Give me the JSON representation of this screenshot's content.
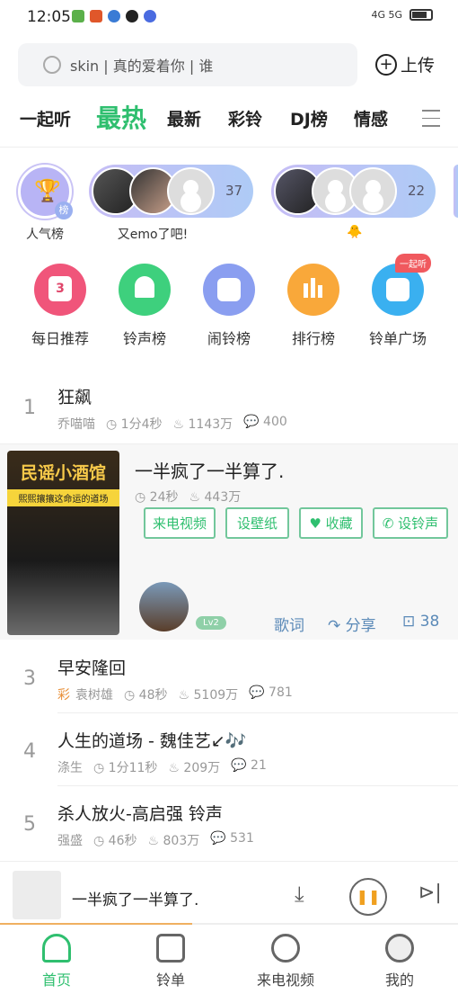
{
  "status": {
    "time": "12:05",
    "network": "4G 5G"
  },
  "search": {
    "placeholder": "skin | 真的爱着你 | 谁",
    "upload": "上传"
  },
  "tabs": [
    "一起听",
    "最热",
    "最新",
    "彩铃",
    "DJ榜",
    "情感"
  ],
  "accent": "#2fbf6f",
  "rooms": [
    {
      "label": "人气榜",
      "badge": "榜"
    },
    {
      "label": "又emo了吧!",
      "count": "37"
    },
    {
      "label": "🐥",
      "count": "22"
    }
  ],
  "features": [
    {
      "label": "每日推荐",
      "icon": "calendar-icon",
      "color": "#f0557a",
      "glyph": "3"
    },
    {
      "label": "铃声榜",
      "icon": "bell-icon",
      "color": "#3ed07d"
    },
    {
      "label": "闹铃榜",
      "icon": "alarm-icon",
      "color": "#8a9ef0"
    },
    {
      "label": "排行榜",
      "icon": "chart-icon",
      "color": "#f9a83a"
    },
    {
      "label": "铃单广场",
      "icon": "list-icon",
      "color": "#3ab0f0",
      "badge": "一起听"
    }
  ],
  "songs": [
    {
      "rank": "1",
      "title": "狂飙",
      "artist": "乔喵喵",
      "duration": "1分4秒",
      "plays": "1143万",
      "comments": "400"
    },
    {
      "title": "一半疯了一半算了.",
      "duration": "24秒",
      "plays": "443万",
      "thumb_title": "民谣小酒馆",
      "thumb_sub": "熙熙攘攘这命运的道场",
      "level": "Lv2",
      "actions": [
        "来电视频",
        "设壁纸",
        "收藏",
        "设铃声"
      ],
      "lyrics": "歌词",
      "share": "分享",
      "comments": "38"
    },
    {
      "rank": "3",
      "title": "早安隆回",
      "tag": "彩",
      "artist": "袁树雄",
      "duration": "48秒",
      "plays": "5109万",
      "comments": "781"
    },
    {
      "rank": "4",
      "title": "人生的道场 - 魏佳艺↙🎶",
      "artist": "涤生",
      "duration": "1分11秒",
      "plays": "209万",
      "comments": "21"
    },
    {
      "rank": "5",
      "title": "杀人放火-高启强 铃声",
      "artist": "强盛",
      "duration": "46秒",
      "plays": "803万",
      "comments": "531"
    }
  ],
  "player": {
    "title": "一半疯了一半算了.",
    "progress": 0.42
  },
  "nav": [
    "首页",
    "铃单",
    "来电视频",
    "我的"
  ]
}
